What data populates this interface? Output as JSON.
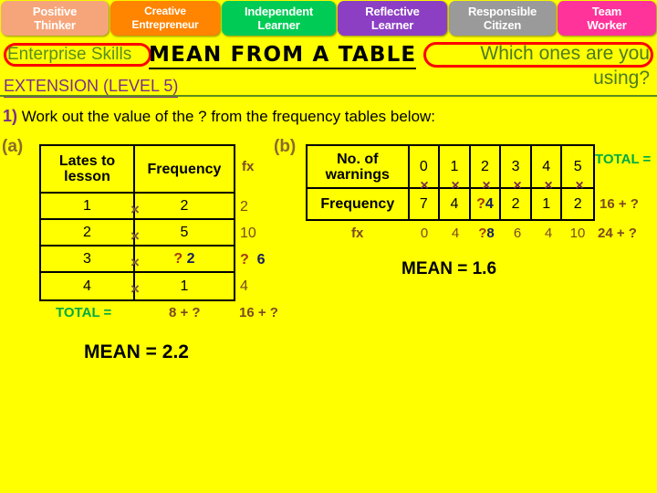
{
  "skills_bar": {
    "items": [
      {
        "line1": "Positive",
        "line2": "Thinker",
        "color": "#F6A57A"
      },
      {
        "line1": "Creative",
        "line2": "Entrepreneur",
        "color": "#FF8400"
      },
      {
        "line1": "Independent",
        "line2": "Learner",
        "color": "#00CC55"
      },
      {
        "line1": "Reflective",
        "line2": "Learner",
        "color": "#8D3FC4"
      },
      {
        "line1": "Responsible",
        "line2": "Citizen",
        "color": "#9A9A9A"
      },
      {
        "line1": "Team",
        "line2": "Worker",
        "color": "#FF3399"
      }
    ]
  },
  "header": {
    "enterprise_label": "Enterprise Skills",
    "title": "MEAN FROM A TABLE",
    "extension": "EXTENSION (LEVEL 5)",
    "prompt_line1": "Which ones are you",
    "prompt_line2": "using?",
    "accent_red": "#FF0000",
    "accent_green": "#5B8C1E",
    "accent_purple": "#7B2D8E",
    "background": "#FFFF00"
  },
  "question": {
    "number": "1)",
    "text": "Work out the value of the ? from the frequency tables below:"
  },
  "part_a": {
    "label": "(a)",
    "headers": [
      "Lates to lesson",
      "Frequency"
    ],
    "header_line1": "Lates to",
    "header_line2": "lesson",
    "header_freq": "Frequency",
    "rows": [
      {
        "value": "1",
        "times": "×",
        "frequency": "2",
        "freq_q": "",
        "freq_ans": "",
        "fx": "2",
        "fx_q": "",
        "fx_ans": ""
      },
      {
        "value": "2",
        "times": "×",
        "frequency": "5",
        "freq_q": "",
        "freq_ans": "",
        "fx": "10",
        "fx_q": "",
        "fx_ans": ""
      },
      {
        "value": "3",
        "times": "×",
        "frequency": "",
        "freq_q": "?",
        "freq_ans": "2",
        "fx": "",
        "fx_q": "?",
        "fx_ans": "6"
      },
      {
        "value": "4",
        "times": "×",
        "frequency": "1",
        "freq_q": "",
        "freq_ans": "",
        "fx": "4",
        "fx_q": "",
        "fx_ans": ""
      }
    ],
    "fx_label": "fx",
    "total_label": "TOTAL =",
    "total_frequency": "8 + ?",
    "total_fx": "16 + ?",
    "mean": "MEAN = 2.2"
  },
  "part_b": {
    "label": "(b)",
    "row_label_1_line1": "No. of",
    "row_label_1_line2": "warnings",
    "row_label_2": "Frequency",
    "warnings": [
      "0",
      "1",
      "2",
      "3",
      "4",
      "5"
    ],
    "times": [
      "×",
      "×",
      "×",
      "×",
      "×",
      "×"
    ],
    "frequencies": [
      {
        "value": "7",
        "q": "",
        "ans": ""
      },
      {
        "value": "4",
        "q": "",
        "ans": ""
      },
      {
        "value": "",
        "q": "?",
        "ans": "4"
      },
      {
        "value": "2",
        "q": "",
        "ans": ""
      },
      {
        "value": "1",
        "q": "",
        "ans": ""
      },
      {
        "value": "2",
        "q": "",
        "ans": ""
      }
    ],
    "fx_label": "fx",
    "fx_values": [
      {
        "value": "0",
        "q": "",
        "ans": ""
      },
      {
        "value": "4",
        "q": "",
        "ans": ""
      },
      {
        "value": "",
        "q": "?",
        "ans": "8"
      },
      {
        "value": "6",
        "q": "",
        "ans": ""
      },
      {
        "value": "4",
        "q": "",
        "ans": ""
      },
      {
        "value": "10",
        "q": "",
        "ans": ""
      }
    ],
    "total_label": "TOTAL =",
    "total_frequency": "16 + ?",
    "total_fx": "24 + ?",
    "mean": "MEAN = 1.6"
  },
  "colors": {
    "question_mark": "#A33A10",
    "answer_number": "#16205E",
    "fx_brown": "#7A4A20",
    "total_green": "#00AA44",
    "cross_a": "#7A5C45",
    "cross_b": "#7A2F4A"
  }
}
